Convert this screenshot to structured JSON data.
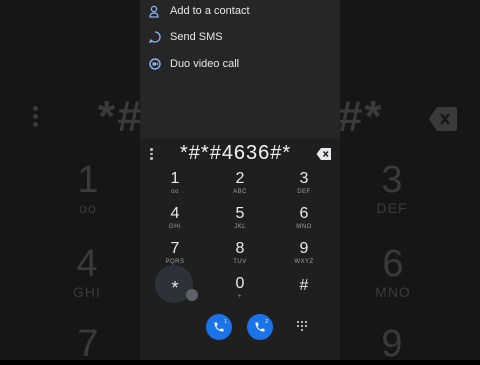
{
  "background": {
    "number": "*#*#4636#*",
    "keys": [
      {
        "digit": "1",
        "letters": "oo"
      },
      {
        "digit": "3",
        "letters": "DEF"
      },
      {
        "digit": "4",
        "letters": "GHI"
      },
      {
        "digit": "6",
        "letters": "MNO"
      },
      {
        "digit": "7",
        "letters": ""
      },
      {
        "digit": "9",
        "letters": ""
      }
    ]
  },
  "menu": {
    "items": [
      {
        "label": "Add to a contact",
        "icon": "person-add-icon"
      },
      {
        "label": "Send SMS",
        "icon": "message-icon"
      },
      {
        "label": "Duo video call",
        "icon": "duo-icon"
      }
    ]
  },
  "dialer": {
    "number": "*#*#4636#*",
    "keys": [
      {
        "digit": "1",
        "letters": "oo"
      },
      {
        "digit": "2",
        "letters": "ABC"
      },
      {
        "digit": "3",
        "letters": "DEF"
      },
      {
        "digit": "4",
        "letters": "GHI"
      },
      {
        "digit": "5",
        "letters": "JKL"
      },
      {
        "digit": "6",
        "letters": "MNO"
      },
      {
        "digit": "7",
        "letters": "PQRS"
      },
      {
        "digit": "8",
        "letters": "TUV"
      },
      {
        "digit": "9",
        "letters": "WXYZ"
      },
      {
        "digit": "*",
        "letters": ""
      },
      {
        "digit": "0",
        "letters": "+"
      },
      {
        "digit": "#",
        "letters": ""
      }
    ],
    "call_sim1_label": "1",
    "call_sim2_label": "2"
  },
  "colors": {
    "accent": "#1a73e8",
    "background": "#1f1f1f",
    "menu_background": "#262626"
  }
}
